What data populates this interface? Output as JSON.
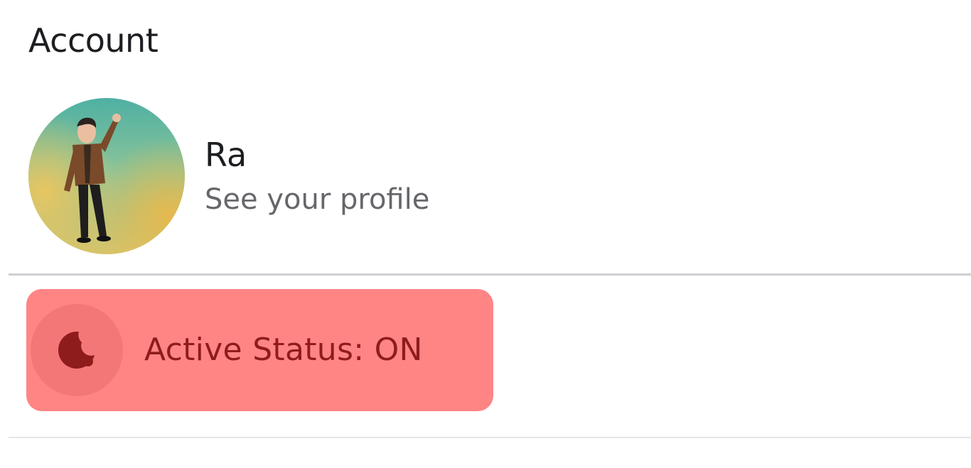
{
  "section": {
    "title": "Account"
  },
  "profile": {
    "name": "Ra",
    "subtitle": "See your profile",
    "avatar_icon": "avatar-waving-person"
  },
  "menu": {
    "active_status": {
      "label": "Active Status: ON",
      "icon": "active-status-icon",
      "highlight_color": "#ff8585",
      "text_color": "#8f1c1c"
    }
  }
}
